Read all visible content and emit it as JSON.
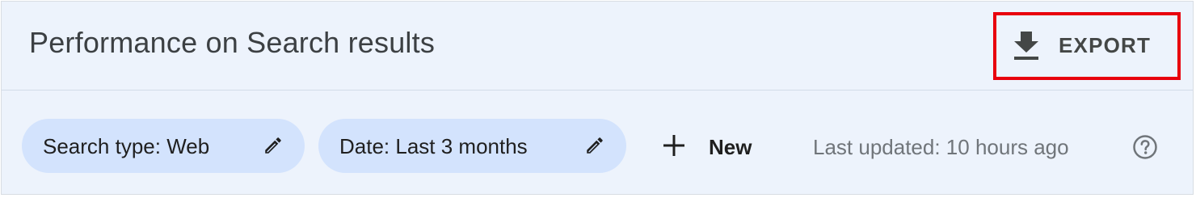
{
  "header": {
    "title": "Performance on Search results",
    "export": {
      "label": "EXPORT",
      "icon": "download-icon",
      "highlight_color": "#e8000d"
    }
  },
  "filters": {
    "chips": [
      {
        "label": "Search type: Web",
        "icon": "pencil-icon"
      },
      {
        "label": "Date: Last 3 months",
        "icon": "pencil-icon"
      }
    ],
    "new": {
      "label": "New",
      "icon": "plus-icon"
    },
    "last_updated": "Last updated: 10 hours ago",
    "help_icon": "help-circle-icon"
  },
  "colors": {
    "background": "#edf3fc",
    "chip": "#d3e3fd",
    "title": "#3c4043",
    "muted": "#70757a"
  }
}
